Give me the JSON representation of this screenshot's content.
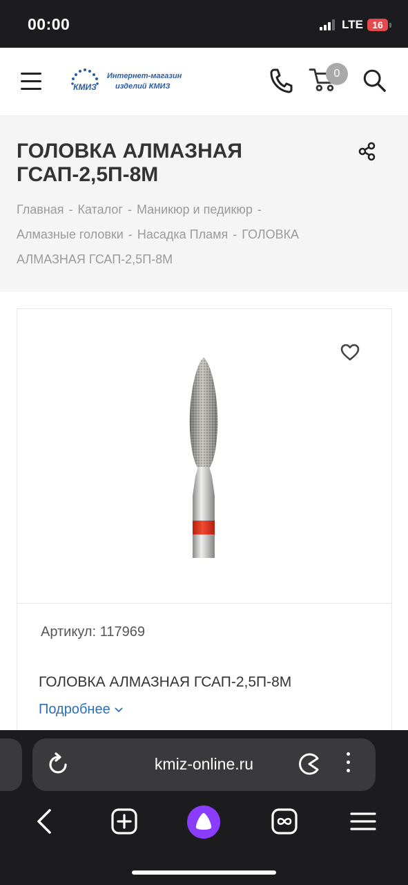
{
  "status_bar": {
    "time": "00:00",
    "network": "LTE",
    "battery": "16"
  },
  "header": {
    "logo": {
      "mark_text": "КМИЗ",
      "line1": "Интернет-магазин",
      "line2": "изделий КМИЗ"
    },
    "cart_count": "0",
    "icons": [
      "hamburger-menu-icon",
      "phone-icon",
      "cart-icon",
      "search-icon"
    ]
  },
  "page": {
    "title": "ГОЛОВКА АЛМАЗНАЯ ГСАП-2,5П-8М",
    "breadcrumb": [
      "Главная",
      "Каталог",
      "Маникюр и педикюр",
      "Алмазные головки",
      "Насадка Пламя",
      "ГОЛОВКА АЛМАЗНАЯ ГСАП-2,5П-8М"
    ],
    "breadcrumb_separator": "-"
  },
  "product": {
    "article_label": "Артикул:",
    "article_value": "117969",
    "name": "ГОЛОВКА АЛМАЗНАЯ ГСАП-2,5П-8М",
    "more_label": "Подробнее",
    "band_color": "#e2321e"
  },
  "browser": {
    "url": "kmiz-online.ru",
    "icons": [
      "reload-icon",
      "pacman-icon",
      "more-vertical-icon",
      "back-icon",
      "new-tab-icon",
      "alice-icon",
      "tabs-icon",
      "menu-icon"
    ]
  },
  "colors": {
    "link": "#2a6ebb",
    "logo": "#2b5aa3",
    "dark_bg": "#1c1c1e",
    "alice": "#8b3dff"
  }
}
